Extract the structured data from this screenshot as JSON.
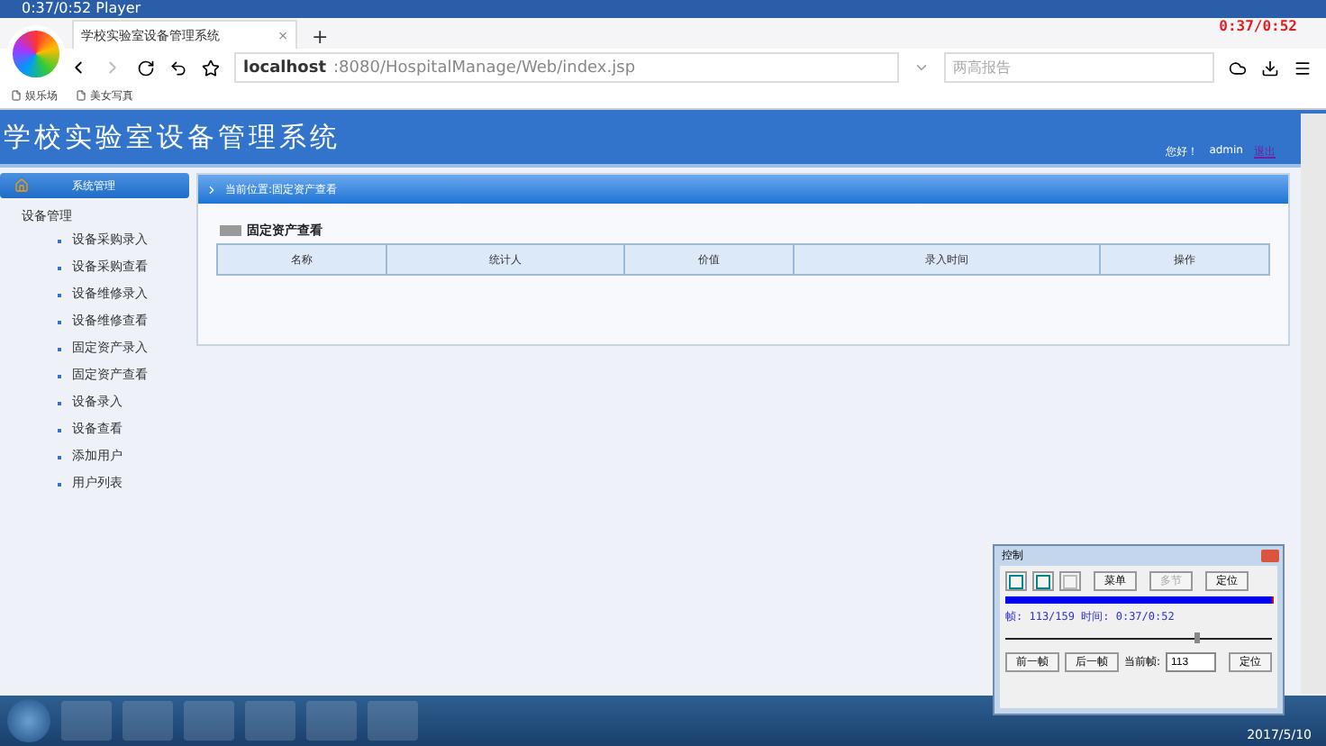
{
  "player_bar": {
    "title": "0:37/0:52 Player",
    "overlay_time": "0:37/0:52"
  },
  "browser": {
    "tabs": [
      {
        "label": "学校实验室设备管理系统",
        "selected": true
      }
    ],
    "new_tab": "+",
    "tab_close": "×",
    "url_host": "localhost",
    "url_rest": ":8080/HospitalManage/Web/index.jsp",
    "search_placeholder": "两高报告",
    "bookmarks": [
      "娱乐场",
      "美女写真"
    ]
  },
  "app": {
    "title": "学校实验室设备管理系统",
    "greeting": "您好！",
    "user": "admin",
    "logout": "退出"
  },
  "sidebar": {
    "header": "系统管理",
    "items": [
      {
        "label": "设备管理",
        "children": [
          {
            "label": "设备采购录入"
          },
          {
            "label": "设备采购查看"
          },
          {
            "label": "设备维修录入"
          },
          {
            "label": "设备维修查看"
          },
          {
            "label": "固定资产录入"
          },
          {
            "label": "固定资产查看"
          },
          {
            "label": "设备录入"
          },
          {
            "label": "设备查看"
          },
          {
            "label": "添加用户"
          },
          {
            "label": "用户列表"
          }
        ]
      }
    ]
  },
  "breadcrumb": "当前位置:固定资产查看",
  "section_title": "固定资产查看",
  "table": {
    "columns": [
      "名称",
      "统计人",
      "价值",
      "录入时间",
      "操作"
    ]
  },
  "control": {
    "title": "控制",
    "buttons": [
      {
        "kind": "icon",
        "disabled": false
      },
      {
        "kind": "icon",
        "disabled": false
      },
      {
        "kind": "icon",
        "disabled": true
      },
      {
        "kind": "text",
        "label": "菜单",
        "disabled": false
      },
      {
        "kind": "text",
        "label": "多节",
        "disabled": true
      },
      {
        "kind": "text",
        "label": "定位",
        "disabled": false
      }
    ],
    "progress": {
      "level": 1
    },
    "status": "帧: 113/159 时间: 0:37/0:52",
    "slider": {
      "level": 0.71
    },
    "prev": "前一帧",
    "next": "后一帧",
    "frame_label": "当前帧:",
    "frame_value": "113",
    "locate": "定位"
  },
  "taskbar": {
    "date": "2017/5/10"
  }
}
